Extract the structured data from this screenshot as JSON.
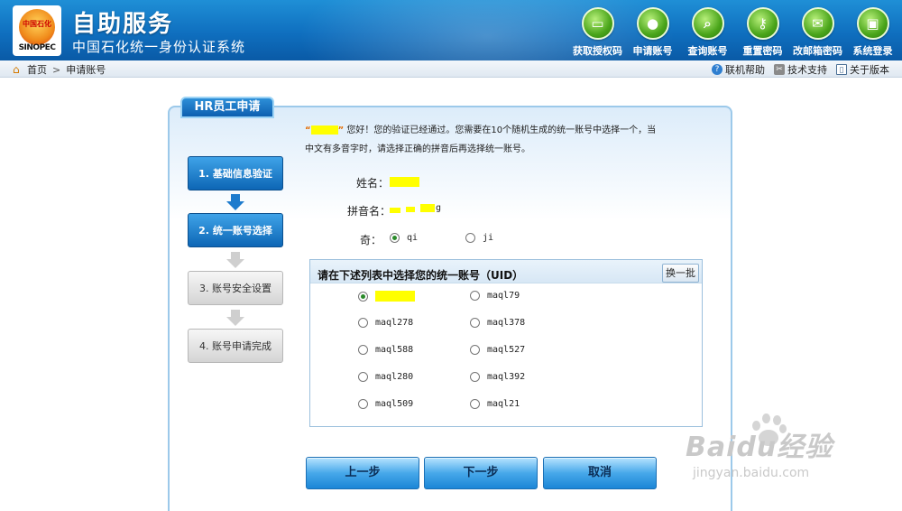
{
  "header": {
    "logo_cn": "中国石化",
    "logo_en": "SINOPEC",
    "title": "自助服务",
    "subtitle": "中国石化统一身份认证系统",
    "nav": [
      {
        "label": "获取授权码",
        "icon": "authcode-icon",
        "glyph": "▭"
      },
      {
        "label": "申请账号",
        "icon": "user-icon",
        "glyph": "●"
      },
      {
        "label": "查询账号",
        "icon": "search-icon",
        "glyph": "⌕"
      },
      {
        "label": "重置密码",
        "icon": "key-icon",
        "glyph": "⚷"
      },
      {
        "label": "改邮箱密码",
        "icon": "mail-icon",
        "glyph": "✉"
      },
      {
        "label": "系统登录",
        "icon": "monitor-icon",
        "glyph": "▣"
      }
    ]
  },
  "breadcrumb": {
    "home": "首页",
    "sep": ">",
    "current": "申请账号",
    "links": [
      "联机帮助",
      "技术支持",
      "关于版本"
    ]
  },
  "panel": {
    "tab": "HR员工申请",
    "msg_line1_open": "“",
    "msg_line1_close": "”",
    "msg_line1_rest": "您好！您的验证已经通过。您需要在10个随机生成的统一账号中选择一个，当",
    "msg_line2": "中文有多音字时，请选择正确的拼音后再选择统一账号。"
  },
  "steps": [
    {
      "label": "1. 基础信息验证",
      "state": "done"
    },
    {
      "label": "2. 统一账号选择",
      "state": "done"
    },
    {
      "label": "3. 账号安全设置",
      "state": "pending"
    },
    {
      "label": "4. 账号申请完成",
      "state": "pending"
    }
  ],
  "form": {
    "name_label": "姓名：",
    "pinyin_label": "拼音名：",
    "pinyin_tail": "g",
    "char_label": "奇：",
    "char_options": [
      {
        "value": "qi",
        "selected": true
      },
      {
        "value": "ji",
        "selected": false
      }
    ]
  },
  "uid": {
    "title": "请在下述列表中选择您的统一账号（UID）",
    "refresh": "换一批",
    "options": [
      {
        "value": "",
        "selected": true,
        "redacted": true
      },
      {
        "value": "maql79",
        "selected": false
      },
      {
        "value": "maql278",
        "selected": false
      },
      {
        "value": "maql378",
        "selected": false
      },
      {
        "value": "maql588",
        "selected": false
      },
      {
        "value": "maql527",
        "selected": false
      },
      {
        "value": "maql280",
        "selected": false
      },
      {
        "value": "maql392",
        "selected": false
      },
      {
        "value": "maql509",
        "selected": false
      },
      {
        "value": "maql21",
        "selected": false
      }
    ]
  },
  "buttons": {
    "prev": "上一步",
    "next": "下一步",
    "cancel": "取消"
  },
  "watermark": {
    "big": "Baidu经验",
    "small": "jingyan.baidu.com"
  }
}
